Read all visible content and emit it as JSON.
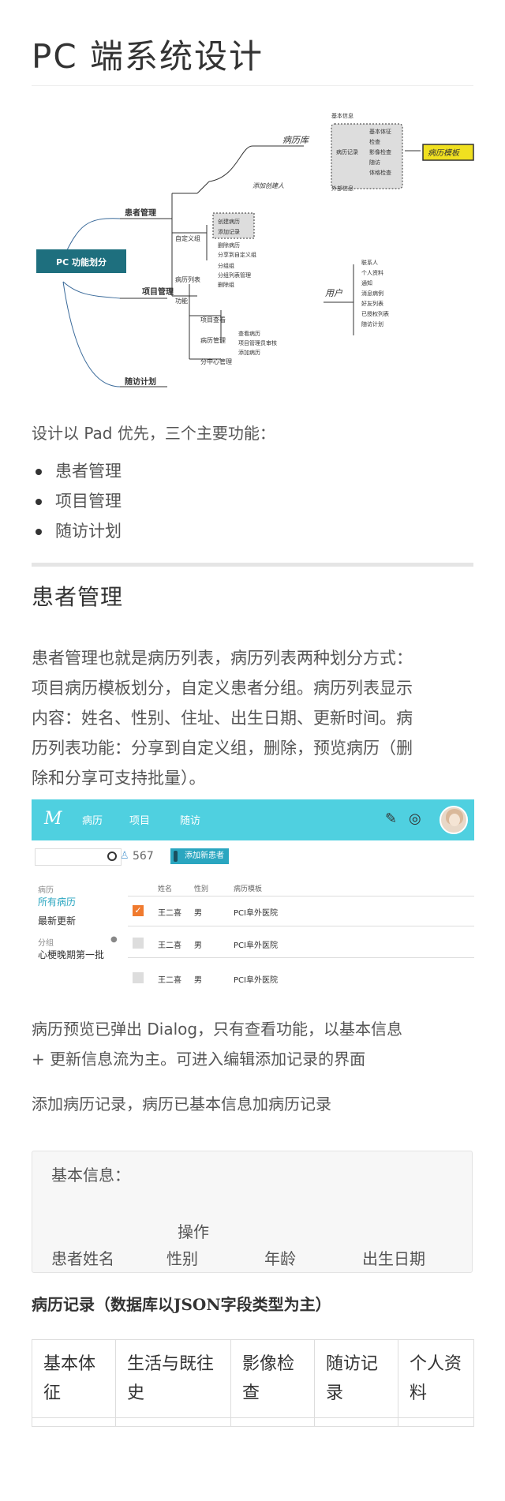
{
  "title": "PC 端系统设计",
  "mindmap": {
    "root": "PC 功能划分",
    "branches": {
      "patients": "患者管理",
      "projects": "项目管理",
      "followup": "随访计划"
    },
    "patient_children": [
      "自定义组",
      "病历列表",
      "功能"
    ],
    "patient_sub": [
      "创建病历",
      "添加记录",
      "删除病历",
      "分享到自定义组",
      "分组组",
      "分组列表管理",
      "删除组"
    ],
    "project_children": [
      "项目查看",
      "病历管理",
      "分中心管理"
    ],
    "project_sub": [
      "查看病历",
      "项目管理员审核",
      "添加病历"
    ],
    "record": {
      "label": "病历库",
      "via": "添加创建人",
      "top": "基本信息",
      "mid": "病历记录",
      "bottom": "外部信息"
    },
    "record_sub": [
      "基本体征",
      "检查",
      "影像检查",
      "随访",
      "体格检查"
    ],
    "template": "病历模板",
    "user": {
      "label": "用户",
      "items": [
        "联系人",
        "个人资料",
        "通知",
        "消息病例",
        "好友列表",
        "已授权列表",
        "随访计划"
      ]
    }
  },
  "intro": "设计以 Pad 优先，三个主要功能：",
  "bullets": [
    "患者管理",
    "项目管理",
    "随访计划"
  ],
  "section": {
    "heading": "患者管理",
    "para_lines": [
      "患者管理也就是病历列表，病历列表两种划分方式：",
      "项目病历模板划分，自定义患者分组。病历列表显示",
      "内容：姓名、性别、住址、出生日期、更新时间。病",
      "历列表功能：分享到自定义组，删除，预览病历（删",
      "除和分享可支持批量）。"
    ]
  },
  "app": {
    "logo": "M",
    "nav": [
      "病历",
      "项目",
      "随访"
    ],
    "count": "567",
    "add_button": "添加新患者",
    "sidebar": {
      "group1": "病历",
      "all": "所有病历",
      "recent": "最新更新",
      "group2": "分组",
      "item": "心梗晚期第一批"
    },
    "columns": [
      "姓名",
      "性别",
      "病历模板"
    ],
    "rows": [
      {
        "name": "王二喜",
        "sex": "男",
        "template": "PCI阜外医院",
        "checked": true
      },
      {
        "name": "王二喜",
        "sex": "男",
        "template": "PCI阜外医院",
        "checked": false
      },
      {
        "name": "王二喜",
        "sex": "男",
        "template": "PCI阜外医院",
        "checked": false
      }
    ]
  },
  "preview_lines": [
    "病历预览已弹出 Dialog，只有查看功能，以基本信息",
    "+ 更新信息流为主。可进入编辑添加记录的界面"
  ],
  "add_record": "添加病历记录，病历已基本信息加病历记录",
  "infobox": {
    "title": "基本信息：",
    "op": "操作",
    "fields": [
      "患者姓名",
      "性别",
      "年龄",
      "出生日期"
    ]
  },
  "records_heading": "病历记录（数据库以JSON字段类型为主）",
  "records_table": [
    "基本体征",
    "生活与既往史",
    "影像检查",
    "随访记录",
    "个人资料"
  ]
}
